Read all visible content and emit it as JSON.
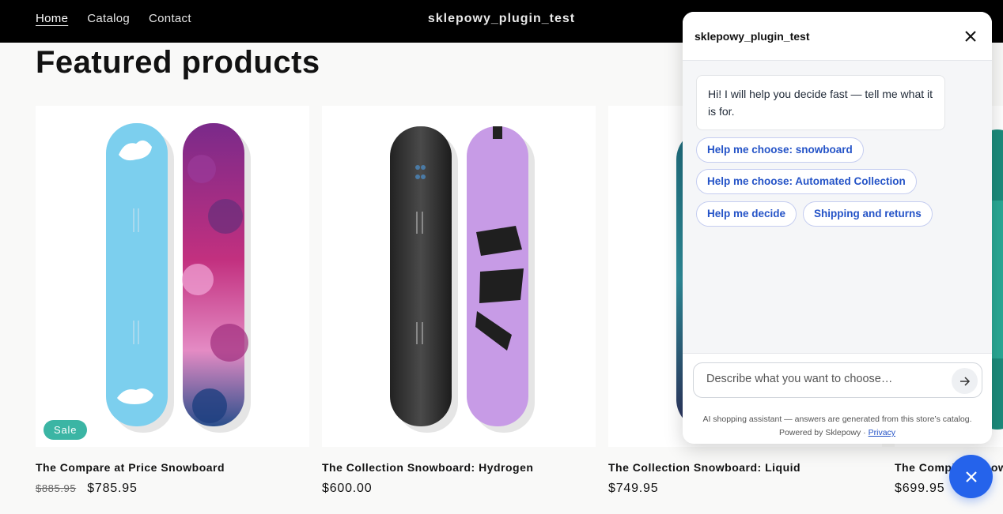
{
  "header": {
    "nav": [
      "Home",
      "Catalog",
      "Contact"
    ],
    "store_title": "sklepowy_plugin_test",
    "icons": [
      "search-icon",
      "account-icon",
      "cart-icon"
    ]
  },
  "section": {
    "title": "Featured products"
  },
  "products": [
    {
      "name": "The Compare at Price Snowboard",
      "compare_price": "$885.95",
      "price": "$785.95",
      "badge": "Sale"
    },
    {
      "name": "The Collection Snowboard: Hydrogen",
      "price": "$600.00"
    },
    {
      "name": "The Collection Snowboard: Liquid",
      "price": "$749.95"
    },
    {
      "name": "The Complete Snowboard",
      "price": "$699.95"
    }
  ],
  "chat": {
    "title": "sklepowy_plugin_test",
    "greeting": "Hi! I will help you decide fast — tell me what it is for.",
    "chips": [
      "Help me choose: snowboard",
      "Help me choose: Automated Collection",
      "Help me decide",
      "Shipping and returns"
    ],
    "input_placeholder": "Describe what you want to choose…",
    "disclaimer": "AI shopping assistant — answers are generated from this store’s catalog.",
    "powered_by": "Powered by Sklepowy",
    "separator": " · ",
    "privacy_link": "Privacy"
  },
  "colors": {
    "accent": "#2563eb",
    "chip_text": "#2453c7",
    "sale_badge": "#3bb5a4",
    "header_bg": "#000000"
  }
}
